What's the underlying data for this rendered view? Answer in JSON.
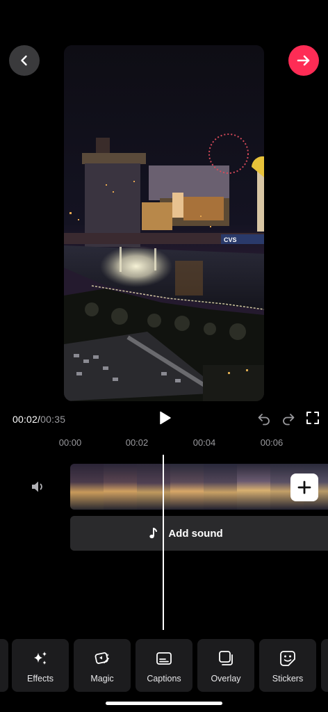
{
  "header": {
    "back_icon": "chevron-left-icon",
    "next_icon": "arrow-right-icon",
    "accent_color": "#fe2c55"
  },
  "preview": {
    "sign_text": "CVS"
  },
  "playback": {
    "current_time": "00:02",
    "separator": "/",
    "total_time": "00:35",
    "icons": [
      "play-icon",
      "undo-icon",
      "redo-icon",
      "fullscreen-icon"
    ]
  },
  "ruler": {
    "ticks": [
      "00:00",
      "00:02",
      "00:04",
      "00:06"
    ]
  },
  "timeline": {
    "add_sound_label": "Add sound",
    "add_clip_icon": "plus-icon",
    "volume_icon": "speaker-icon"
  },
  "toolbar": {
    "items": [
      {
        "label": "Effects",
        "icon": "sparkles-icon"
      },
      {
        "label": "Magic",
        "icon": "magic-icon"
      },
      {
        "label": "Captions",
        "icon": "captions-icon"
      },
      {
        "label": "Overlay",
        "icon": "overlay-icon"
      },
      {
        "label": "Stickers",
        "icon": "sticker-icon"
      }
    ]
  }
}
